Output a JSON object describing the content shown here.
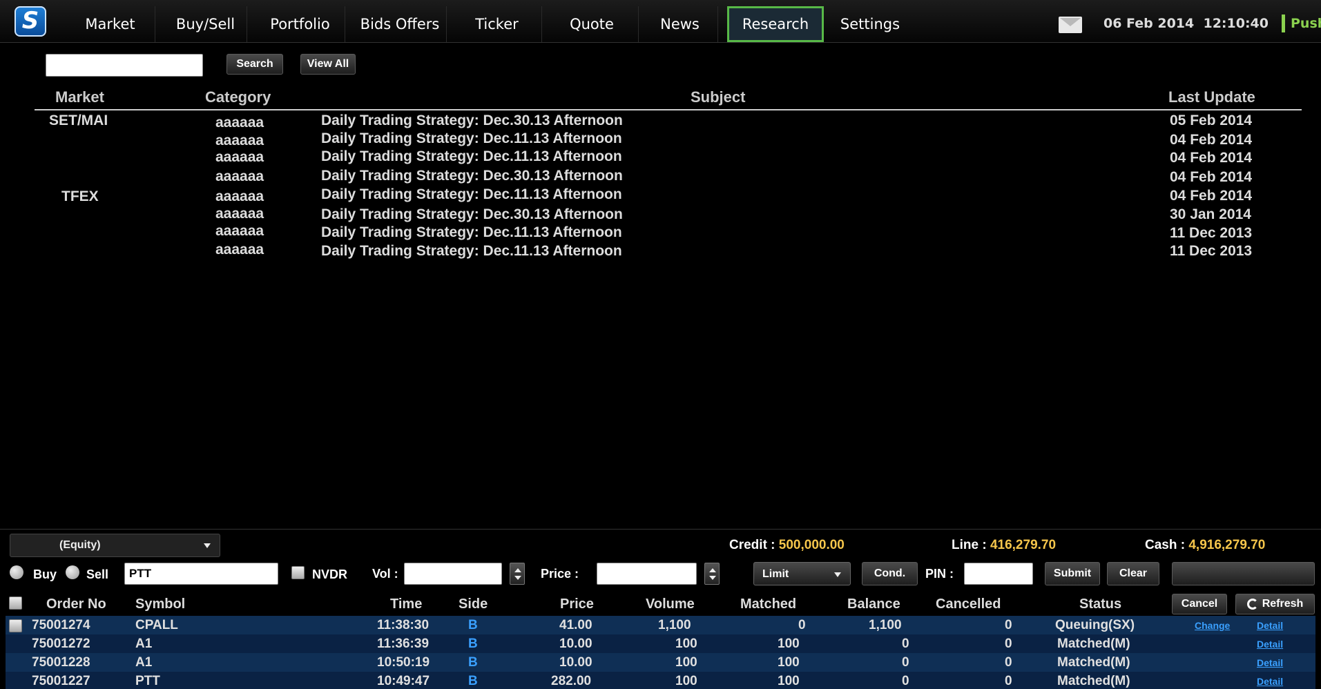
{
  "nav": {
    "logo": "S",
    "items": [
      "Market",
      "Buy/Sell",
      "Portfolio",
      "Bids Offers",
      "Ticker",
      "Quote",
      "News",
      "Research",
      "Settings"
    ],
    "active": "Research",
    "date": "06 Feb 2014",
    "time": "12:10:40",
    "push": "Push"
  },
  "search": {
    "value": "",
    "search_label": "Search",
    "viewall_label": "View All"
  },
  "research": {
    "headers": {
      "market": "Market",
      "category": "Category",
      "subject": "Subject",
      "last_update": "Last Update"
    },
    "markets": [
      "SET/MAI",
      "TFEX"
    ],
    "rows": [
      {
        "category": "aaaaaa",
        "subject": "Daily Trading Strategy: Dec.30.13 Afternoon",
        "date": "05 Feb 2014"
      },
      {
        "category": "aaaaaa",
        "subject": "Daily Trading Strategy: Dec.11.13  Afternoon",
        "date": "04 Feb 2014"
      },
      {
        "category": "aaaaaa",
        "subject": "Daily Trading Strategy: Dec.11.13  Afternoon",
        "date": "04 Feb 2014"
      },
      {
        "category": "aaaaaa",
        "subject": "Daily Trading Strategy: Dec.30.13 Afternoon",
        "date": "04 Feb 2014"
      },
      {
        "category": "aaaaaa",
        "subject": "Daily Trading Strategy: Dec.11.13  Afternoon",
        "date": "04 Feb 2014"
      },
      {
        "category": "aaaaaa",
        "subject": "Daily Trading Strategy: Dec.30.13 Afternoon",
        "date": "30 Jan 2014"
      },
      {
        "category": "aaaaaa",
        "subject": "Daily Trading Strategy: Dec.11.13  Afternoon",
        "date": "11 Dec 2013"
      },
      {
        "category": "aaaaaa",
        "subject": "Daily Trading Strategy: Dec.11.13  Afternoon",
        "date": "11 Dec 2013"
      }
    ]
  },
  "order_entry": {
    "account": "(Equity)",
    "credit_label": "Credit :",
    "credit_value": "500,000.00",
    "line_label": "Line :",
    "line_value": "416,279.70",
    "cash_label": "Cash :",
    "cash_value": "4,916,279.70",
    "buy_label": "Buy",
    "sell_label": "Sell",
    "symbol_value": "PTT",
    "nvdr_label": "NVDR",
    "vol_label": "Vol :",
    "price_label": "Price :",
    "order_type": "Limit",
    "cond_label": "Cond.",
    "pin_label": "PIN :",
    "submit_label": "Submit",
    "clear_label": "Clear"
  },
  "orders": {
    "headers": {
      "order_no": "Order No",
      "symbol": "Symbol",
      "time": "Time",
      "side": "Side",
      "price": "Price",
      "volume": "Volume",
      "matched": "Matched",
      "balance": "Balance",
      "cancelled": "Cancelled",
      "status": "Status"
    },
    "cancel_label": "Cancel",
    "refresh_label": "Refresh",
    "change_label": "Change",
    "detail_label": "Detail",
    "rows": [
      {
        "order_no": "75001274",
        "symbol": "CPALL",
        "time": "11:38:30",
        "side": "B",
        "price": "41.00",
        "volume": "1,100",
        "matched": "0",
        "balance": "1,100",
        "cancelled": "0",
        "status": "Queuing(SX)"
      },
      {
        "order_no": "75001272",
        "symbol": "A1",
        "time": "11:36:39",
        "side": "B",
        "price": "10.00",
        "volume": "100",
        "matched": "100",
        "balance": "0",
        "cancelled": "0",
        "status": "Matched(M)"
      },
      {
        "order_no": "75001228",
        "symbol": "A1",
        "time": "10:50:19",
        "side": "B",
        "price": "10.00",
        "volume": "100",
        "matched": "100",
        "balance": "0",
        "cancelled": "0",
        "status": "Matched(M)"
      },
      {
        "order_no": "75001227",
        "symbol": "PTT",
        "time": "10:49:47",
        "side": "B",
        "price": "282.00",
        "volume": "100",
        "matched": "100",
        "balance": "0",
        "cancelled": "0",
        "status": "Matched(M)"
      }
    ]
  }
}
